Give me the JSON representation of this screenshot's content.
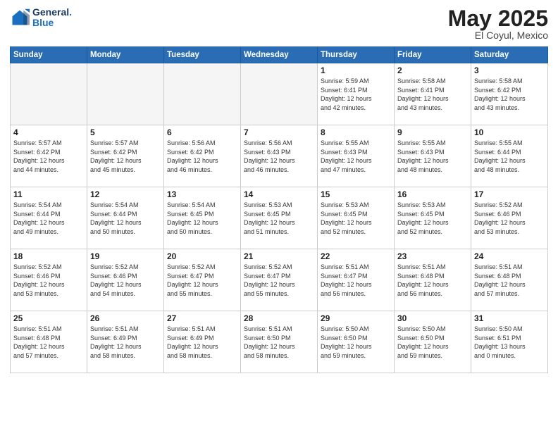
{
  "header": {
    "logo_line1": "General",
    "logo_line2": "Blue",
    "month_year": "May 2025",
    "location": "El Coyul, Mexico"
  },
  "weekdays": [
    "Sunday",
    "Monday",
    "Tuesday",
    "Wednesday",
    "Thursday",
    "Friday",
    "Saturday"
  ],
  "weeks": [
    [
      {
        "day": "",
        "info": ""
      },
      {
        "day": "",
        "info": ""
      },
      {
        "day": "",
        "info": ""
      },
      {
        "day": "",
        "info": ""
      },
      {
        "day": "1",
        "info": "Sunrise: 5:59 AM\nSunset: 6:41 PM\nDaylight: 12 hours\nand 42 minutes."
      },
      {
        "day": "2",
        "info": "Sunrise: 5:58 AM\nSunset: 6:41 PM\nDaylight: 12 hours\nand 43 minutes."
      },
      {
        "day": "3",
        "info": "Sunrise: 5:58 AM\nSunset: 6:42 PM\nDaylight: 12 hours\nand 43 minutes."
      }
    ],
    [
      {
        "day": "4",
        "info": "Sunrise: 5:57 AM\nSunset: 6:42 PM\nDaylight: 12 hours\nand 44 minutes."
      },
      {
        "day": "5",
        "info": "Sunrise: 5:57 AM\nSunset: 6:42 PM\nDaylight: 12 hours\nand 45 minutes."
      },
      {
        "day": "6",
        "info": "Sunrise: 5:56 AM\nSunset: 6:42 PM\nDaylight: 12 hours\nand 46 minutes."
      },
      {
        "day": "7",
        "info": "Sunrise: 5:56 AM\nSunset: 6:43 PM\nDaylight: 12 hours\nand 46 minutes."
      },
      {
        "day": "8",
        "info": "Sunrise: 5:55 AM\nSunset: 6:43 PM\nDaylight: 12 hours\nand 47 minutes."
      },
      {
        "day": "9",
        "info": "Sunrise: 5:55 AM\nSunset: 6:43 PM\nDaylight: 12 hours\nand 48 minutes."
      },
      {
        "day": "10",
        "info": "Sunrise: 5:55 AM\nSunset: 6:44 PM\nDaylight: 12 hours\nand 48 minutes."
      }
    ],
    [
      {
        "day": "11",
        "info": "Sunrise: 5:54 AM\nSunset: 6:44 PM\nDaylight: 12 hours\nand 49 minutes."
      },
      {
        "day": "12",
        "info": "Sunrise: 5:54 AM\nSunset: 6:44 PM\nDaylight: 12 hours\nand 50 minutes."
      },
      {
        "day": "13",
        "info": "Sunrise: 5:54 AM\nSunset: 6:45 PM\nDaylight: 12 hours\nand 50 minutes."
      },
      {
        "day": "14",
        "info": "Sunrise: 5:53 AM\nSunset: 6:45 PM\nDaylight: 12 hours\nand 51 minutes."
      },
      {
        "day": "15",
        "info": "Sunrise: 5:53 AM\nSunset: 6:45 PM\nDaylight: 12 hours\nand 52 minutes."
      },
      {
        "day": "16",
        "info": "Sunrise: 5:53 AM\nSunset: 6:45 PM\nDaylight: 12 hours\nand 52 minutes."
      },
      {
        "day": "17",
        "info": "Sunrise: 5:52 AM\nSunset: 6:46 PM\nDaylight: 12 hours\nand 53 minutes."
      }
    ],
    [
      {
        "day": "18",
        "info": "Sunrise: 5:52 AM\nSunset: 6:46 PM\nDaylight: 12 hours\nand 53 minutes."
      },
      {
        "day": "19",
        "info": "Sunrise: 5:52 AM\nSunset: 6:46 PM\nDaylight: 12 hours\nand 54 minutes."
      },
      {
        "day": "20",
        "info": "Sunrise: 5:52 AM\nSunset: 6:47 PM\nDaylight: 12 hours\nand 55 minutes."
      },
      {
        "day": "21",
        "info": "Sunrise: 5:52 AM\nSunset: 6:47 PM\nDaylight: 12 hours\nand 55 minutes."
      },
      {
        "day": "22",
        "info": "Sunrise: 5:51 AM\nSunset: 6:47 PM\nDaylight: 12 hours\nand 56 minutes."
      },
      {
        "day": "23",
        "info": "Sunrise: 5:51 AM\nSunset: 6:48 PM\nDaylight: 12 hours\nand 56 minutes."
      },
      {
        "day": "24",
        "info": "Sunrise: 5:51 AM\nSunset: 6:48 PM\nDaylight: 12 hours\nand 57 minutes."
      }
    ],
    [
      {
        "day": "25",
        "info": "Sunrise: 5:51 AM\nSunset: 6:48 PM\nDaylight: 12 hours\nand 57 minutes."
      },
      {
        "day": "26",
        "info": "Sunrise: 5:51 AM\nSunset: 6:49 PM\nDaylight: 12 hours\nand 58 minutes."
      },
      {
        "day": "27",
        "info": "Sunrise: 5:51 AM\nSunset: 6:49 PM\nDaylight: 12 hours\nand 58 minutes."
      },
      {
        "day": "28",
        "info": "Sunrise: 5:51 AM\nSunset: 6:50 PM\nDaylight: 12 hours\nand 58 minutes."
      },
      {
        "day": "29",
        "info": "Sunrise: 5:50 AM\nSunset: 6:50 PM\nDaylight: 12 hours\nand 59 minutes."
      },
      {
        "day": "30",
        "info": "Sunrise: 5:50 AM\nSunset: 6:50 PM\nDaylight: 12 hours\nand 59 minutes."
      },
      {
        "day": "31",
        "info": "Sunrise: 5:50 AM\nSunset: 6:51 PM\nDaylight: 13 hours\nand 0 minutes."
      }
    ]
  ]
}
